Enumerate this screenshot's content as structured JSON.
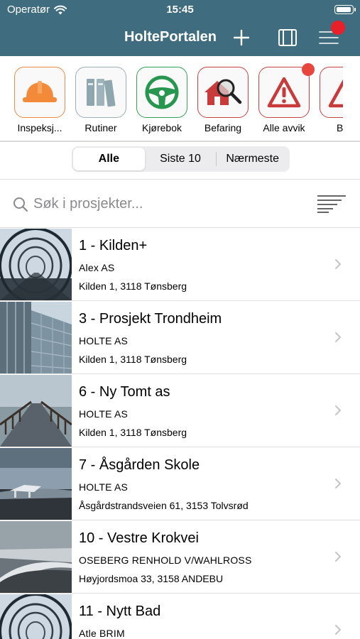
{
  "status": {
    "carrier": "Operatør",
    "time": "15:45"
  },
  "header": {
    "title": "HoltePortalen"
  },
  "shortcuts": [
    {
      "label": "Inspeksj...",
      "icon": "hard-hat-icon"
    },
    {
      "label": "Rutiner",
      "icon": "binders-icon"
    },
    {
      "label": "Kjørebok",
      "icon": "steering-wheel-icon"
    },
    {
      "label": "Befaring",
      "icon": "house-magnifier-icon"
    },
    {
      "label": "Alle avvik",
      "icon": "warning-icon"
    },
    {
      "label": "Bec",
      "icon": "warning-icon"
    }
  ],
  "segments": {
    "all": "Alle",
    "last10": "Siste 10",
    "nearest": "Nærmeste",
    "selected": "Alle"
  },
  "search": {
    "placeholder": "Søk i prosjekter..."
  },
  "projects": [
    {
      "title": "1 - Kilden+",
      "company": "Alex AS",
      "address": "Kilden 1, 3118 Tønsberg",
      "image": "tunnel-bridge"
    },
    {
      "title": "3 - Prosjekt Trondheim",
      "company": "HOLTE AS",
      "address": "Kilden 1, 3118 Tønsberg",
      "image": "glass-building"
    },
    {
      "title": "6 - Ny Tomt as",
      "company": "HOLTE AS",
      "address": "Kilden 1, 3118 Tønsberg",
      "image": "pier"
    },
    {
      "title": "7 - Åsgården Skole",
      "company": "HOLTE AS",
      "address": "Åsgårdstrandsveien 61, 3153 Tolvsrød",
      "image": "coastal-building"
    },
    {
      "title": "10 - Vestre Krokvei",
      "company": "OSEBERG RENHOLD V/WAHLROSS",
      "address": "Høyjordsmoa 33, 3158 ANDEBU",
      "image": "sea-wall"
    },
    {
      "title": "11 - Nytt Bad",
      "company": "Atle BRIM",
      "address": "",
      "image": "tunnel-bridge"
    }
  ],
  "colors": {
    "header": "#3f6d7f",
    "notification": "#e8202a"
  }
}
